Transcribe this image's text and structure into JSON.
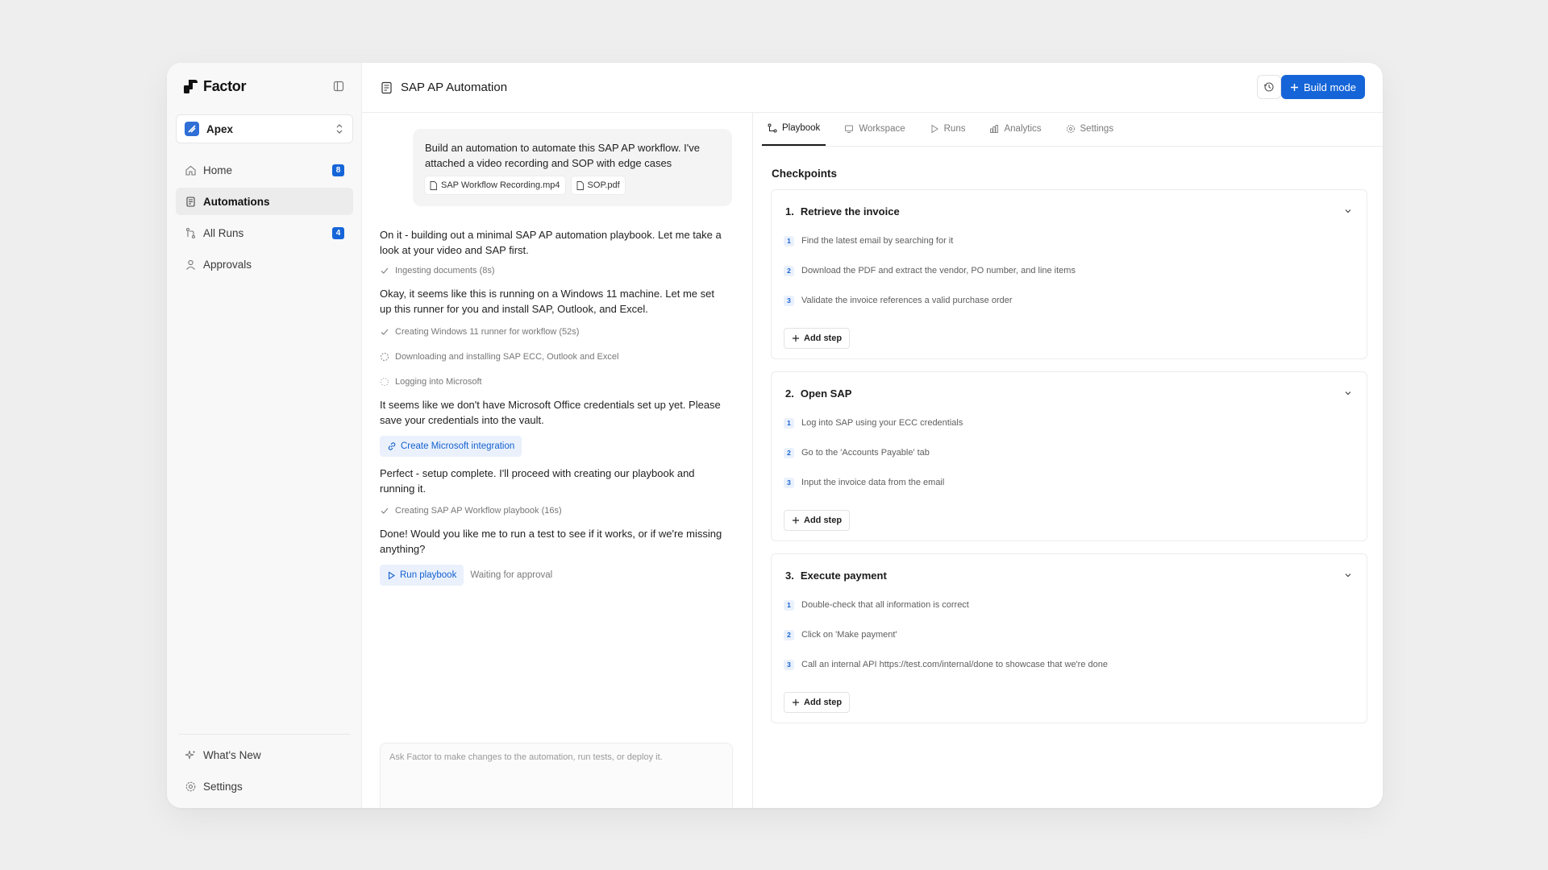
{
  "brand": {
    "name": "Factor"
  },
  "workspace": {
    "name": "Apex"
  },
  "sidebar": {
    "items": [
      {
        "label": "Home",
        "badge": "8",
        "icon": "home-icon"
      },
      {
        "label": "Automations",
        "icon": "document-icon",
        "active": true
      },
      {
        "label": "All Runs",
        "badge": "4",
        "icon": "branch-icon"
      },
      {
        "label": "Approvals",
        "icon": "user-icon"
      }
    ],
    "bottom": [
      {
        "label": "What's New",
        "icon": "sparkle-icon"
      },
      {
        "label": "Settings",
        "icon": "gear-icon"
      }
    ]
  },
  "header": {
    "title": "SAP AP Automation",
    "build_label": "Build mode"
  },
  "chat": {
    "user_message": "Build an automation to automate this SAP AP workflow. I've attached a video recording and SOP with edge cases",
    "attachments": [
      "SAP Workflow Recording.mp4",
      "SOP.pdf"
    ],
    "msg1": "On it - building out a minimal SAP AP automation playbook. Let me take a look at your video and SAP first.",
    "status1": "Ingesting documents (8s)",
    "msg2": "Okay, it seems like this is running on a Windows 11 machine. Let me set up this runner for you and install SAP, Outlook, and Excel.",
    "status2": "Creating Windows 11 runner for workflow (52s)",
    "status3": "Downloading and installing SAP ECC, Outlook and Excel",
    "status4": "Logging into Microsoft",
    "msg3": "It seems like we don't have Microsoft Office credentials set up yet. Please save your credentials into the vault.",
    "integration_label": "Create Microsoft integration",
    "msg4": "Perfect - setup complete. I'll proceed with creating our playbook and running it.",
    "status5": "Creating SAP AP Workflow playbook (16s)",
    "msg5": "Done! Would you like me to run a test to see if it works, or if we're missing anything?",
    "run_label": "Run playbook",
    "waiting_label": "Waiting for approval",
    "composer_placeholder": "Ask Factor to make changes to the automation, run tests, or deploy it."
  },
  "tabs": [
    "Playbook",
    "Workspace",
    "Runs",
    "Analytics",
    "Settings"
  ],
  "checkpoints": {
    "title": "Checkpoints",
    "add_step_label": "Add step",
    "items": [
      {
        "num": "1.",
        "title": "Retrieve the invoice",
        "steps": [
          {
            "n": "1",
            "text": "Find the latest email by searching for it"
          },
          {
            "n": "2",
            "text": "Download the PDF and extract the vendor, PO number, and line items"
          },
          {
            "n": "3",
            "text": "Validate the invoice references a valid purchase order"
          }
        ]
      },
      {
        "num": "2.",
        "title": "Open SAP",
        "steps": [
          {
            "n": "1",
            "text": "Log into SAP using your ECC credentials"
          },
          {
            "n": "2",
            "text": "Go to the 'Accounts Payable' tab"
          },
          {
            "n": "3",
            "text": "Input the invoice data from the email"
          }
        ]
      },
      {
        "num": "3.",
        "title": "Execute payment",
        "steps": [
          {
            "n": "1",
            "text": "Double-check that all information is correct"
          },
          {
            "n": "2",
            "text": "Click on 'Make payment'"
          },
          {
            "n": "3",
            "text": "Call an internal API https://test.com/internal/done to showcase that we're done"
          }
        ]
      }
    ]
  },
  "colors": {
    "accent": "#1565d8",
    "accent_soft": "#eaf1fc",
    "sidebar_bg": "#f8f8f8"
  }
}
